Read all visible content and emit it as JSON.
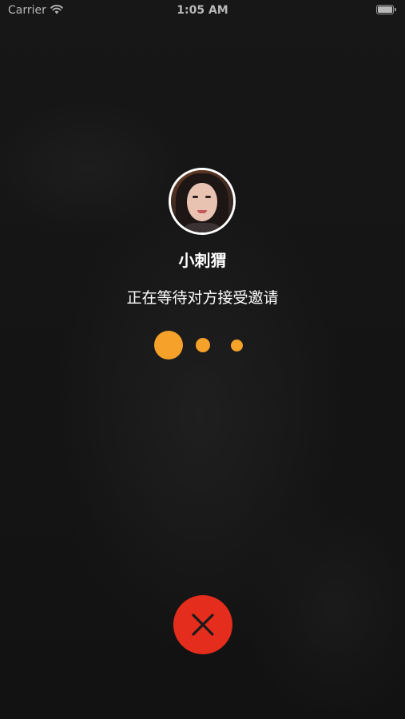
{
  "status_bar": {
    "carrier": "Carrier",
    "time": "1:05 AM",
    "wifi_icon": "wifi-icon",
    "battery_icon": "battery-full-icon"
  },
  "call": {
    "callee_name": "小刺猬",
    "status": "正在等待对方接受邀请",
    "avatar_icon": "avatar-photo",
    "waiting_indicator_color": "#f6a12a"
  },
  "controls": {
    "hangup_icon": "close-icon",
    "hangup_color": "#e42d1c"
  }
}
